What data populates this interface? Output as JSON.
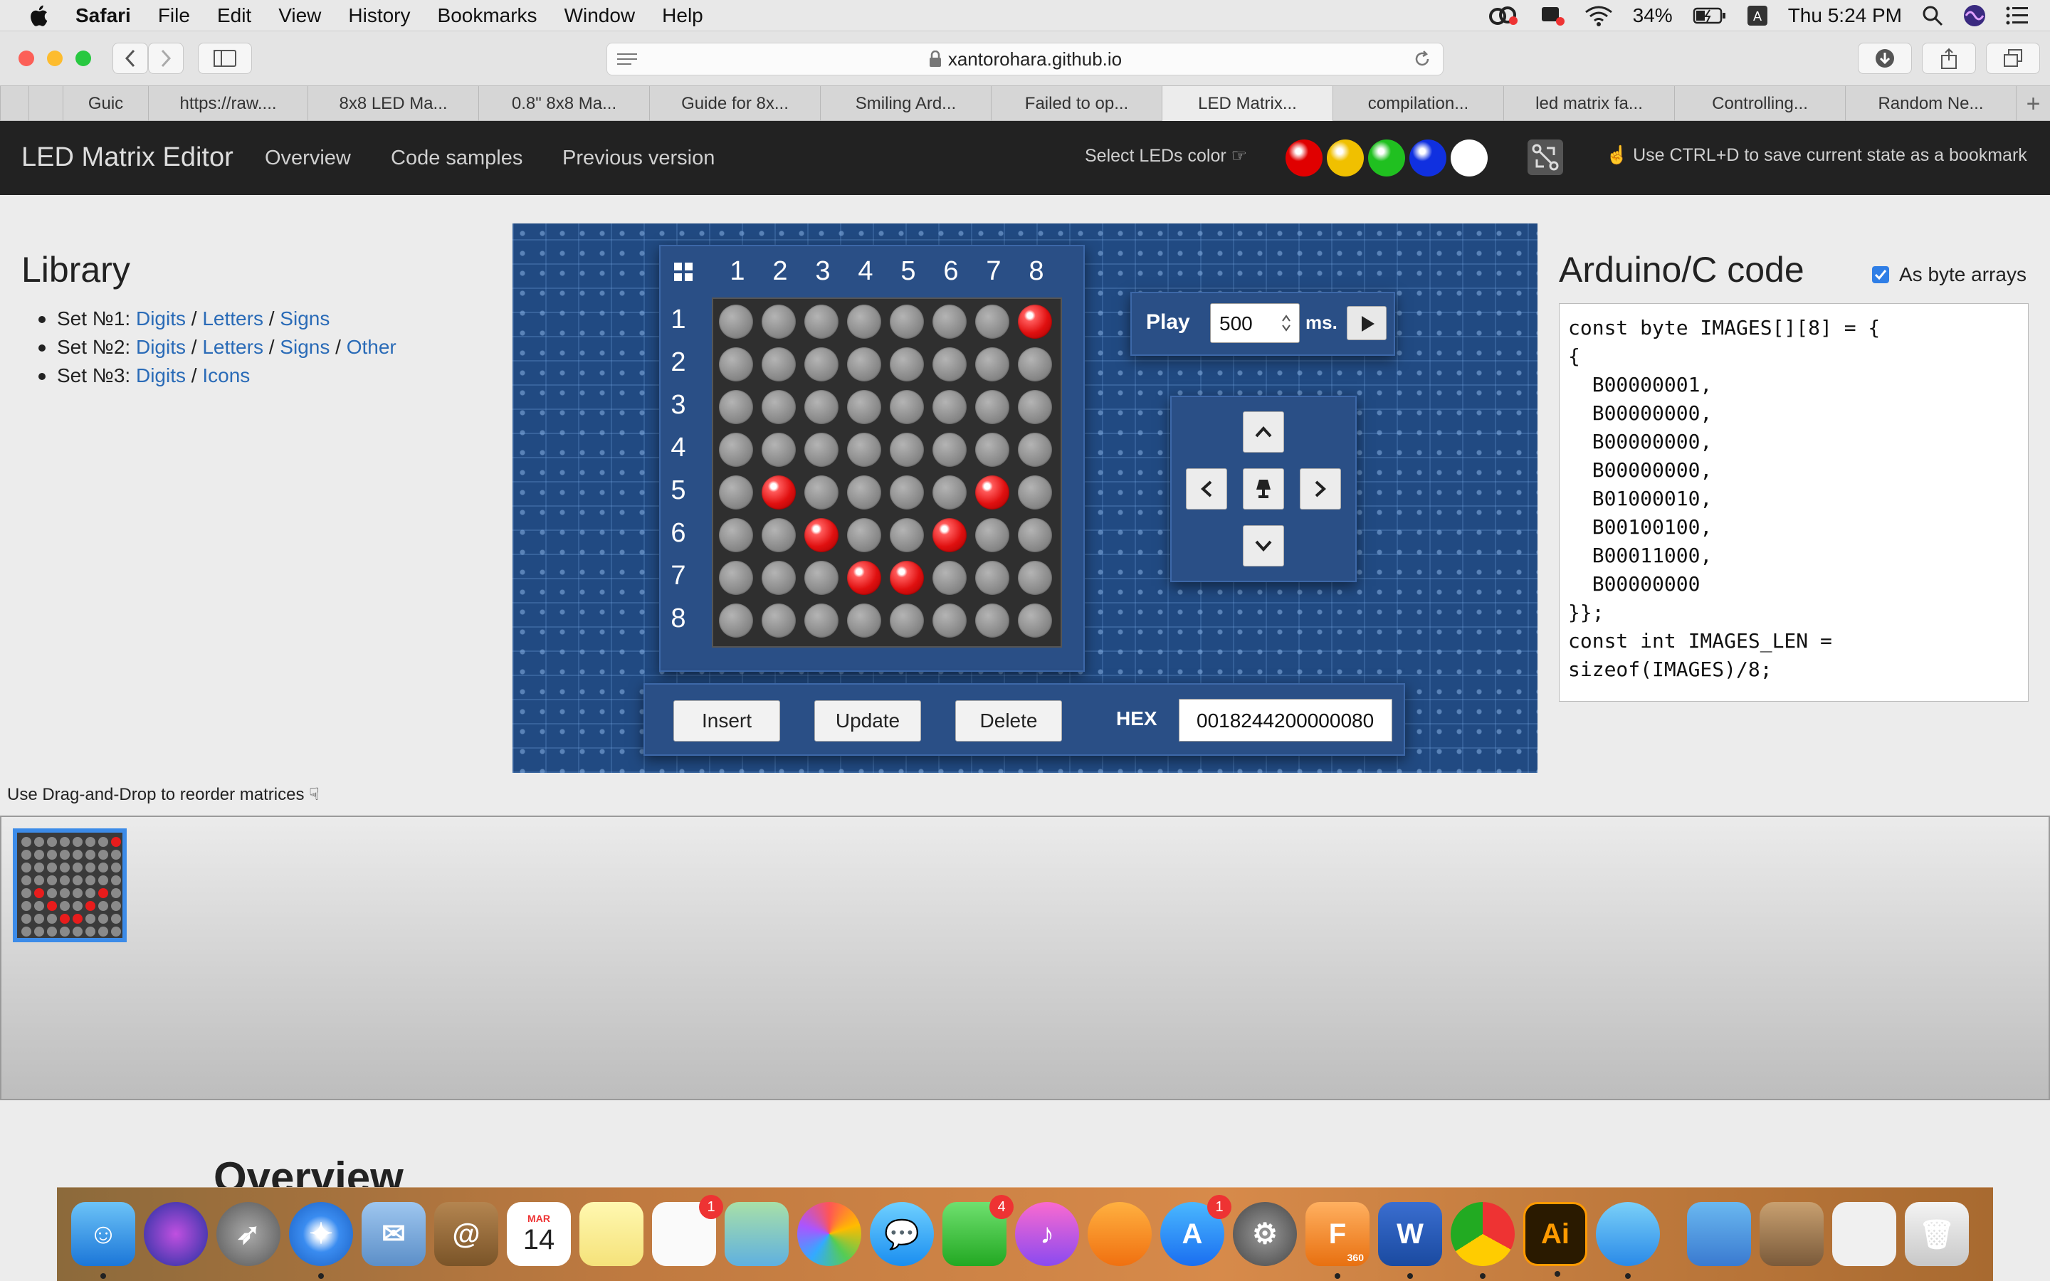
{
  "menubar": {
    "items": [
      "Safari",
      "File",
      "Edit",
      "View",
      "History",
      "Bookmarks",
      "Window",
      "Help"
    ],
    "battery": "34%",
    "clock": "Thu 5:24 PM"
  },
  "browser": {
    "url": "xantorohara.github.io",
    "tabs": [
      "Guic",
      "https://raw....",
      "8x8 LED Ma...",
      "0.8\" 8x8 Ma...",
      "Guide for 8x...",
      "Smiling Ard...",
      "Failed to op...",
      "LED Matrix...",
      "compilation...",
      "led matrix fa...",
      "Controlling...",
      "Random Ne..."
    ],
    "active_tab": 7
  },
  "navbar": {
    "brand": "LED Matrix Editor",
    "links": [
      "Overview",
      "Code samples",
      "Previous version"
    ],
    "color_label": "Select LEDs color ☞",
    "colors": [
      "#e00000",
      "#f0c000",
      "#20c020",
      "#1030e0",
      "#ffffff"
    ],
    "bookmark_note": "☝ Use CTRL+D to save current state as a bookmark"
  },
  "library": {
    "title": "Library",
    "sets": [
      {
        "label": "Set №1: ",
        "links": [
          "Digits",
          "Letters",
          "Signs"
        ]
      },
      {
        "label": "Set №2: ",
        "links": [
          "Digits",
          "Letters",
          "Signs",
          "Other"
        ]
      },
      {
        "label": "Set №3: ",
        "links": [
          "Digits",
          "Icons"
        ]
      }
    ]
  },
  "matrix": {
    "col_numbers": [
      "1",
      "2",
      "3",
      "4",
      "5",
      "6",
      "7",
      "8"
    ],
    "row_numbers": [
      "1",
      "2",
      "3",
      "4",
      "5",
      "6",
      "7",
      "8"
    ],
    "rows": [
      [
        0,
        0,
        0,
        0,
        0,
        0,
        0,
        1
      ],
      [
        0,
        0,
        0,
        0,
        0,
        0,
        0,
        0
      ],
      [
        0,
        0,
        0,
        0,
        0,
        0,
        0,
        0
      ],
      [
        0,
        0,
        0,
        0,
        0,
        0,
        0,
        0
      ],
      [
        0,
        1,
        0,
        0,
        0,
        0,
        1,
        0
      ],
      [
        0,
        0,
        1,
        0,
        0,
        1,
        0,
        0
      ],
      [
        0,
        0,
        0,
        1,
        1,
        0,
        0,
        0
      ],
      [
        0,
        0,
        0,
        0,
        0,
        0,
        0,
        0
      ]
    ]
  },
  "play": {
    "label": "Play",
    "interval": "500",
    "unit": "ms."
  },
  "actions": {
    "insert": "Insert",
    "update": "Update",
    "delete": "Delete",
    "hex_label": "HEX",
    "hex_value": "0018244200000080"
  },
  "code": {
    "title": "Arduino/C code",
    "checkbox_label": "As byte arrays",
    "checkbox_checked": true,
    "text": "const byte IMAGES[][8] = {\n{\n  B00000001,\n  B00000000,\n  B00000000,\n  B00000000,\n  B01000010,\n  B00100100,\n  B00011000,\n  B00000000\n}};\nconst int IMAGES_LEN =\nsizeof(IMAGES)/8;"
  },
  "reorder_note": "Use Drag-and-Drop to reorder matrices ☟",
  "overview_heading": "Overview",
  "dock": {
    "calendar_month": "MAR",
    "calendar_day": "14",
    "badges": {
      "reminders": "1",
      "facetime": "4",
      "appstore": "1"
    },
    "fusion_label": "360",
    "illustrator_label": "Ai"
  }
}
